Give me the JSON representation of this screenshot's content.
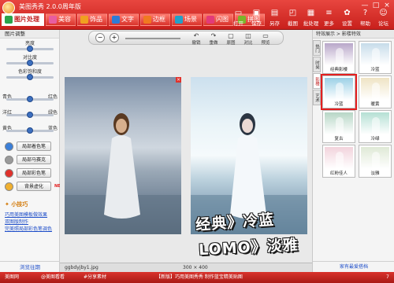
{
  "app": {
    "title": "美图秀秀 2.0.0周年版"
  },
  "window": {
    "min": "—",
    "max": "□",
    "close": "×"
  },
  "tabs": [
    {
      "label": "图片处理",
      "color": "#29a34a"
    },
    {
      "label": "美容",
      "color": "#e85da0"
    },
    {
      "label": "饰品",
      "color": "#f0a020"
    },
    {
      "label": "文字",
      "color": "#2e7bd6"
    },
    {
      "label": "边框",
      "color": "#f07a20"
    },
    {
      "label": "场景",
      "color": "#22a0c8"
    },
    {
      "label": "闪图",
      "color": "#e23a7a"
    },
    {
      "label": "拼图",
      "color": "#7cb42a"
    }
  ],
  "toptools": [
    {
      "label": "打开",
      "icon": "folder-icon",
      "glyph": "▭"
    },
    {
      "label": "保存",
      "icon": "save-icon",
      "glyph": "▣"
    },
    {
      "label": "另存",
      "icon": "saveas-icon",
      "glyph": "▤"
    },
    {
      "label": "截图",
      "icon": "screenshot-icon",
      "glyph": "◰"
    },
    {
      "label": "批处理",
      "icon": "batch-icon",
      "glyph": "▦"
    },
    {
      "label": "更多",
      "icon": "more-icon",
      "glyph": "≡"
    },
    {
      "label": "设置",
      "icon": "gear-icon",
      "glyph": "✿"
    },
    {
      "label": "帮助",
      "icon": "help-icon",
      "glyph": "?"
    },
    {
      "label": "论坛",
      "icon": "forum-icon",
      "glyph": "☺"
    }
  ],
  "left": {
    "header": "图片调整",
    "sliders": [
      {
        "label": "亮度",
        "left": "",
        "right": "",
        "value": 0.5
      },
      {
        "label": "对比度",
        "left": "",
        "right": "",
        "value": 0.5
      },
      {
        "label": "色彩饱和度",
        "left": "",
        "right": "",
        "value": 0.5
      },
      {
        "label": "色调调节",
        "left": "青色",
        "right": "红色",
        "value": 0.5
      },
      {
        "label": "",
        "left": "洋红",
        "right": "绿色",
        "value": 0.5
      },
      {
        "label": "",
        "left": "黄色",
        "right": "蓝色",
        "value": 0.5
      }
    ],
    "buttons": [
      {
        "label": "局部着色笔",
        "swatch": "#3b7fd8"
      },
      {
        "label": "局部马赛克",
        "swatch": "#9a9a9a"
      },
      {
        "label": "局部彩色笔",
        "swatch": "#e0312b"
      },
      {
        "label": "背景虚化",
        "swatch": "#f0b030",
        "badge": "NEW"
      }
    ],
    "tips_title": "小技巧",
    "tips": [
      "巧用美图模板做效果",
      "双图版制作",
      "完美照局部彩色笔调色"
    ],
    "footer": "浏览往期"
  },
  "center": {
    "zoom_out": "−",
    "zoom_in": "+",
    "tools": [
      {
        "label": "撤销",
        "glyph": "↶"
      },
      {
        "label": "重做",
        "glyph": "↷"
      },
      {
        "label": "原图",
        "glyph": "▢"
      },
      {
        "label": "对比",
        "glyph": "◫"
      },
      {
        "label": "预览",
        "glyph": "▭"
      }
    ],
    "status_file": "ggbdyjby1.jpg",
    "status_size": "300 × 400",
    "overlay_line1": "经典》冷蓝",
    "overlay_line2": "LOMO》淡雅"
  },
  "right": {
    "header": "特效展示 > 影楼特效",
    "vtabs": [
      "热门",
      "时尚",
      "影楼",
      "艺术"
    ],
    "effects": [
      {
        "label": "经典影楼",
        "bg": "#b9a7c9"
      },
      {
        "label": "冷蓝",
        "bg": "#c7dcea"
      },
      {
        "label": "冷蓝",
        "bg": "#9bd0e6"
      },
      {
        "label": "暖黄",
        "bg": "#efe3c4"
      },
      {
        "label": "复古",
        "bg": "#b7d6c6"
      },
      {
        "label": "冷绿",
        "bg": "#b5e0d4"
      },
      {
        "label": "红粉佳人",
        "bg": "#f2d3dc"
      },
      {
        "label": "淡雅",
        "bg": "#dfe9d6"
      }
    ],
    "footer": "家有最爱搭档"
  },
  "bottom": {
    "items": [
      "美图网",
      "@美图看看",
      "#分享素材",
      "【新版】巧用美图秀秀 制作蓝宝精美贴图",
      "7"
    ]
  }
}
